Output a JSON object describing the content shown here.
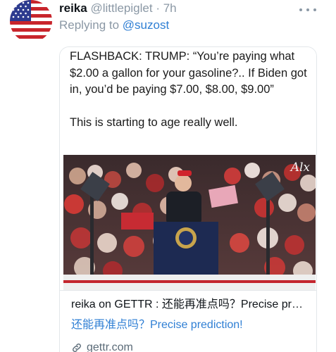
{
  "post": {
    "display_name": "reika",
    "handle": "@littlepiglet",
    "separator": "·",
    "time": "7h",
    "reply_label": "Replying to",
    "reply_handle": "@suzost"
  },
  "card": {
    "caption_text": "FLASHBACK: TRUMP: “You’re paying what $2.00 a gallon for your gasoline?.. If Biden got in, you’d be paying $7.00, $8.00, $9.00”\n\nThis is starting to age really well.",
    "watermark": "Alx",
    "title": "reika on GETTR : 还能再准点吗？Precise prediction!",
    "description": "还能再准点吗？Precise prediction!",
    "domain": "gettr.com"
  },
  "icons": {
    "avatar": "us-flag-avatar",
    "more": "more-horizontal-icon",
    "link": "link-icon"
  },
  "colors": {
    "link_blue": "#2f7fd4",
    "muted_gray": "#8b98a5"
  }
}
